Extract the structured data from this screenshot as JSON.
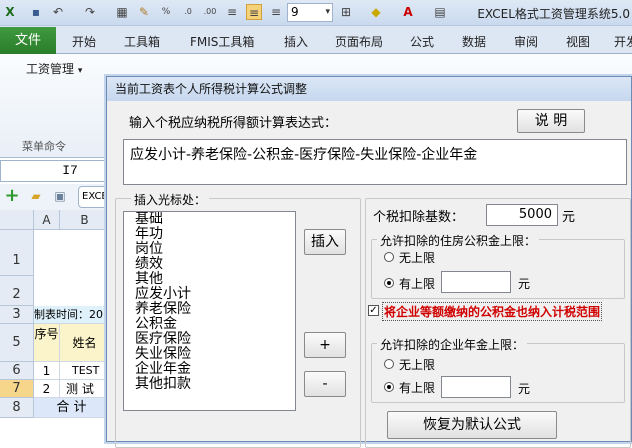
{
  "window": {
    "title": "EXCEL格式工资管理系统5.0"
  },
  "qat": {
    "font_size": "9"
  },
  "ribbon": {
    "file_tab": "文件",
    "tabs": [
      "开始",
      "工具箱",
      "FMIS工具箱",
      "插入",
      "页面布局",
      "公式",
      "数据",
      "审阅",
      "视图",
      "开发"
    ],
    "wage_mgmt": "工资管理",
    "menu_command": "菜单命令"
  },
  "namebox": "I7",
  "toolbar_tab": "EXCE",
  "sheet": {
    "col_a": "A",
    "col_b": "B",
    "rows": [
      {
        "num": "1",
        "a": "",
        "b": ""
      },
      {
        "num": "2",
        "a": "",
        "b": ""
      },
      {
        "num": "3",
        "a": "制表时间：20",
        "b": ""
      },
      {
        "num": "5",
        "a": "序号",
        "b": "姓名"
      },
      {
        "num": "6",
        "a": "1",
        "b": "TEST"
      },
      {
        "num": "7",
        "a": "2",
        "b": "测 试"
      },
      {
        "num": "8",
        "a": "合 计",
        "b": ""
      }
    ]
  },
  "dialog": {
    "title": "当前工资表个人所得税计算公式调整",
    "prompt": "输入个税应纳税所得额计算表达式：",
    "explain_button": "说 明",
    "formula": "应发小计-养老保险-公积金-医疗保险-失业保险-企业年金",
    "insert_group_title": "插入光标处：",
    "insert_items": [
      "基础",
      "年功",
      "岗位",
      "绩效",
      "其他",
      "应发小计",
      "养老保险",
      "公积金",
      "医疗保险",
      "失业保险",
      "企业年金",
      "其他扣款"
    ],
    "insert_button": "插入",
    "plus_button": "+",
    "minus_button": "-",
    "tax_base_label": "个税扣除基数：",
    "tax_base_value": "5000",
    "unit_yuan": "元",
    "housing_group_title": "允许扣除的住房公积金上限：",
    "no_limit": "无上限",
    "has_limit": "有上限",
    "housing_limit_unit": "元",
    "housing_selected": "有上限",
    "include_checkbox_label": "将企业等额缴纳的公积金也纳入计税范围",
    "include_checked": true,
    "annuity_group_title": "允许扣除的企业年金上限：",
    "annuity_selected": "有上限",
    "annuity_limit_unit": "元",
    "restore_button": "恢复为默认公式"
  }
}
